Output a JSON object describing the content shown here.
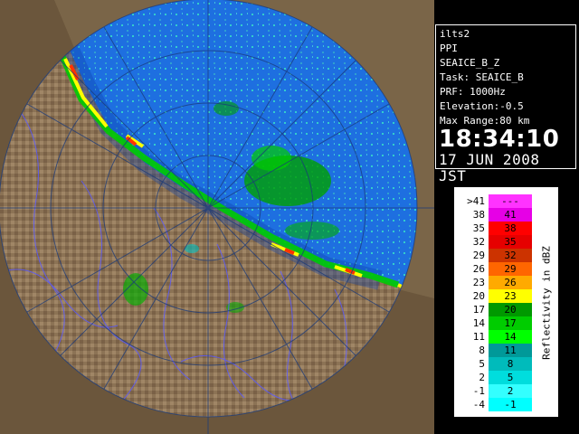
{
  "info": {
    "site": "ilts2",
    "product": "PPI",
    "scan_name": "SEAICE_B_Z",
    "task": "Task: SEAICE_B",
    "prf": "PRF: 1000Hz",
    "elevation": "Elevation:-0.5",
    "max_range": "Max Range:80 km",
    "time": "18:34:10",
    "date": "17 JUN 2008 JST"
  },
  "legend": {
    "unit_label": "Reflectivity in dBZ",
    "rows": [
      {
        "lo": ">41",
        "hi": "---",
        "color": "#ff33ff"
      },
      {
        "lo": "38",
        "hi": "41",
        "color": "#e600e6"
      },
      {
        "lo": "35",
        "hi": "38",
        "color": "#ff0000"
      },
      {
        "lo": "32",
        "hi": "35",
        "color": "#e60000"
      },
      {
        "lo": "29",
        "hi": "32",
        "color": "#cc3300"
      },
      {
        "lo": "26",
        "hi": "29",
        "color": "#ff6600"
      },
      {
        "lo": "23",
        "hi": "26",
        "color": "#ffaa00"
      },
      {
        "lo": "20",
        "hi": "23",
        "color": "#ffff00"
      },
      {
        "lo": "17",
        "hi": "20",
        "color": "#009900"
      },
      {
        "lo": "14",
        "hi": "17",
        "color": "#00cc00"
      },
      {
        "lo": "11",
        "hi": "14",
        "color": "#00ff00"
      },
      {
        "lo": "8",
        "hi": "11",
        "color": "#009999"
      },
      {
        "lo": "5",
        "hi": "8",
        "color": "#00bbbb"
      },
      {
        "lo": "2",
        "hi": "5",
        "color": "#00dddd"
      },
      {
        "lo": "-1",
        "hi": "2",
        "color": "#33ffff"
      },
      {
        "lo": "-4",
        "hi": "-1",
        "color": "#00ffff"
      }
    ]
  },
  "map_colors": {
    "sea": "#1e6fe0",
    "sea_edge": "#2f8fff",
    "land": "#8c7355",
    "land_dark": "#6b5238",
    "river": "#5a5aff",
    "border": "#c84040"
  }
}
